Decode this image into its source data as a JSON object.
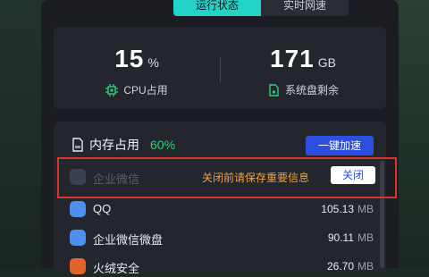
{
  "tabs": [
    {
      "label": "运行状态",
      "active": true
    },
    {
      "label": "实时网速",
      "active": false
    }
  ],
  "stats": {
    "cpu": {
      "value": "15",
      "unit": "%",
      "label": "CPU占用",
      "icon": "cpu-chip-icon"
    },
    "disk": {
      "value": "171",
      "unit": "GB",
      "label": "系统盘剩余",
      "icon": "disk-drive-icon"
    }
  },
  "memory": {
    "title": "内存占用",
    "percent": "60%",
    "boost_label": "一键加速",
    "warning": "关闭前请保存重要信息",
    "close_label": "关闭",
    "processes": [
      {
        "name": "企业微信",
        "size": "",
        "unit": "",
        "icon": "wecom-icon"
      },
      {
        "name": "QQ",
        "size": "105.13",
        "unit": "MB",
        "icon": "qq-icon"
      },
      {
        "name": "企业微信微盘",
        "size": "90.11",
        "unit": "MB",
        "icon": "wecom-drive-icon"
      },
      {
        "name": "火绒安全",
        "size": "26.70",
        "unit": "MB",
        "icon": "huorong-icon"
      }
    ]
  },
  "colors": {
    "accent_tab": "#23d3c8",
    "accent_blue": "#2d4fe0",
    "green": "#2fd07a",
    "warning": "#f0a23a",
    "highlight": "#d9362b"
  }
}
